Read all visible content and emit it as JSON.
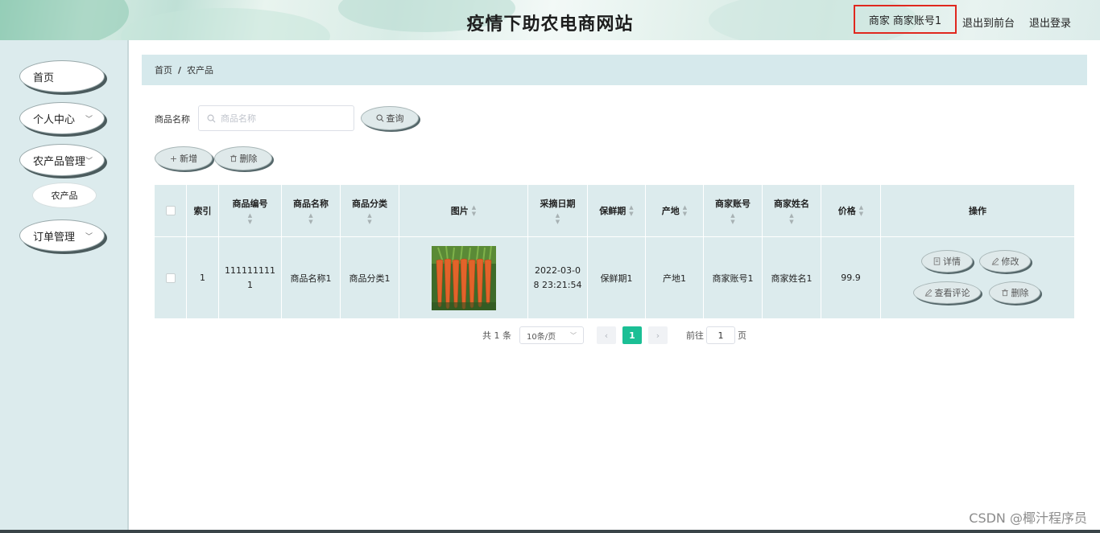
{
  "header": {
    "title": "疫情下助农电商网站",
    "role": "商家",
    "account": "商家账号1",
    "back_to_front": "退出到前台",
    "logout": "退出登录"
  },
  "sidebar": {
    "items": [
      {
        "label": "首页"
      },
      {
        "label": "个人中心"
      },
      {
        "label": "农产品管理"
      },
      {
        "label": "农产品"
      },
      {
        "label": "订单管理"
      }
    ]
  },
  "breadcrumb": {
    "home": "首页",
    "current": "农产品"
  },
  "search": {
    "label": "商品名称",
    "placeholder": "商品名称",
    "value": "",
    "button": "查询"
  },
  "toolbar": {
    "add_label": "新增",
    "delete_label": "删除"
  },
  "table": {
    "headers": [
      "索引",
      "商品编号",
      "商品名称",
      "商品分类",
      "图片",
      "采摘日期",
      "保鲜期",
      "产地",
      "商家账号",
      "商家姓名",
      "价格",
      "操作"
    ],
    "rows": [
      {
        "index": "1",
        "code_line1": "111111111",
        "code_line2": "1",
        "name": "商品名称1",
        "category": "商品分类1",
        "date_line1": "2022-03-0",
        "date_line2": "8 23:21:54",
        "shelf_life": "保鲜期1",
        "origin": "产地1",
        "merchant_account": "商家账号1",
        "merchant_name": "商家姓名1",
        "price": "99.9",
        "actions": {
          "detail": "详情",
          "edit": "修改",
          "comments": "查看评论",
          "delete": "删除"
        }
      }
    ]
  },
  "pagination": {
    "total": "共 1 条",
    "page_size": "10条/页",
    "current_page": "1",
    "goto_prefix": "前往",
    "goto_value": "1",
    "goto_suffix": "页"
  },
  "watermark": "CSDN @椰汁程序员",
  "colors": {
    "sidebar_bg": "#dcebed",
    "table_bg": "#dcebed",
    "accent": "#1bbf95",
    "highlight_border": "#e0281e"
  }
}
